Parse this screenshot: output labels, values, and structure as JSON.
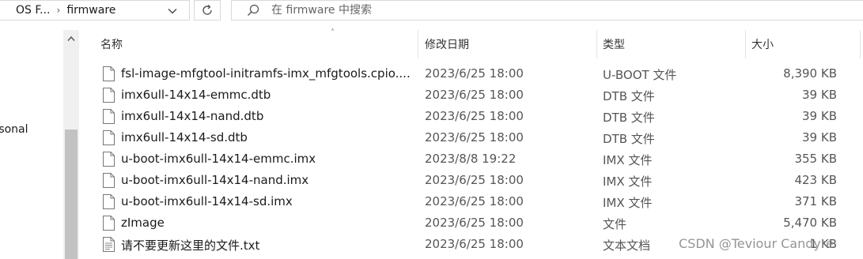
{
  "address_bar": {
    "crumbs": [
      "OS F...",
      "firmware"
    ],
    "dropdown_icon": "chevron-down-icon",
    "refresh_icon": "refresh-icon"
  },
  "search": {
    "placeholder": "在 firmware 中搜索",
    "icon": "search-icon"
  },
  "nav_pane": {
    "item_label": "Personal"
  },
  "columns": {
    "name": "名称",
    "date": "修改日期",
    "type": "类型",
    "size": "大小"
  },
  "files": [
    {
      "name": "fsl-image-mfgtool-initramfs-imx_mfgtools.cpio....",
      "date": "2023/6/25 18:00",
      "type": "U-BOOT 文件",
      "size": "8,390 KB",
      "icon": "file-icon"
    },
    {
      "name": "imx6ull-14x14-emmc.dtb",
      "date": "2023/6/25 18:00",
      "type": "DTB 文件",
      "size": "39 KB",
      "icon": "file-icon"
    },
    {
      "name": "imx6ull-14x14-nand.dtb",
      "date": "2023/6/25 18:00",
      "type": "DTB 文件",
      "size": "39 KB",
      "icon": "file-icon"
    },
    {
      "name": "imx6ull-14x14-sd.dtb",
      "date": "2023/6/25 18:00",
      "type": "DTB 文件",
      "size": "39 KB",
      "icon": "file-icon"
    },
    {
      "name": "u-boot-imx6ull-14x14-emmc.imx",
      "date": "2023/8/8 19:22",
      "type": "IMX 文件",
      "size": "355 KB",
      "icon": "file-icon"
    },
    {
      "name": "u-boot-imx6ull-14x14-nand.imx",
      "date": "2023/6/25 18:00",
      "type": "IMX 文件",
      "size": "423 KB",
      "icon": "file-icon"
    },
    {
      "name": "u-boot-imx6ull-14x14-sd.imx",
      "date": "2023/6/25 18:00",
      "type": "IMX 文件",
      "size": "371 KB",
      "icon": "file-icon"
    },
    {
      "name": "zImage",
      "date": "2023/6/25 18:00",
      "type": "文件",
      "size": "5,470 KB",
      "icon": "file-icon"
    },
    {
      "name": "请不要更新这里的文件.txt",
      "date": "2023/6/25 18:00",
      "type": "文本文档",
      "size": "1 KB",
      "icon": "text-file-icon"
    }
  ],
  "watermark": "CSDN @Teviour Candyre"
}
